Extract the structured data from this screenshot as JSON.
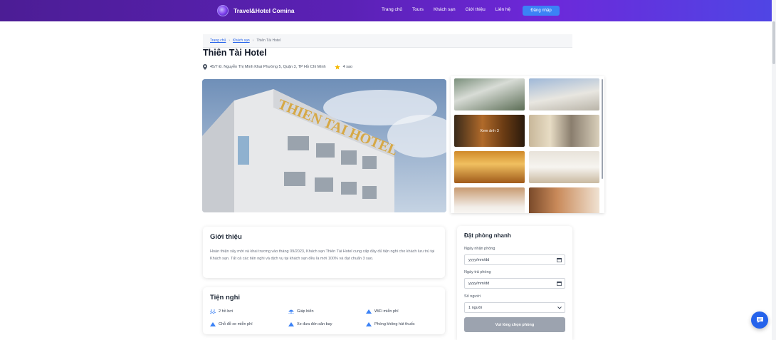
{
  "header": {
    "brand": "Travel&Hotel Comina",
    "nav": [
      "Trang chủ",
      "Tours",
      "Khách sạn",
      "Giới thiệu",
      "Liên hệ"
    ],
    "login_label": "Đăng nhập"
  },
  "breadcrumb": {
    "home": "Trang chủ",
    "hotels": "Khách sạn",
    "current": "Thiên Tài Hotel"
  },
  "hotel": {
    "name": "Thiên Tài Hotel",
    "address": "45/7 Đ. Nguyễn Thị Minh Khai Phường 5, Quận 3, TP Hồ Chí Minh",
    "stars": "4 sao"
  },
  "gallery": {
    "more_label": "Xem ảnh 3"
  },
  "intro": {
    "title": "Giới thiệu",
    "text": "Hoàn thiện xây mới và khai trương vào tháng 09/2023, Khách sạn Thiên Tài Hotel cung cấp đầy đủ tiện nghi cho khách lưu trú tại Khách sạn. Tất cả các tiện nghi và dịch vụ tại khách sạn đều là mới 100% và đạt chuẩn 3 sao."
  },
  "amenities": {
    "title": "Tiện nghi",
    "items": [
      "2 hồ bơi",
      "Giáp biển",
      "WiFi miễn phí",
      "Chỗ đỗ xe miễn phí",
      "Xe đưa đón sân bay",
      "Phòng không hút thuốc"
    ]
  },
  "booking": {
    "title": "Đặt phòng nhanh",
    "checkin_label": "Ngày nhận phòng",
    "checkin_value": "yyyy/mm/dd",
    "checkout_label": "Ngày trả phòng",
    "checkout_value": "yyyy/mm/dd",
    "guests_label": "Số người",
    "guests_value": "1 người",
    "submit_label": "Vui lòng chọn phòng"
  },
  "colors": {
    "header_start": "#4c1d95",
    "header_end": "#4f46e5",
    "accent": "#3b82f6",
    "star": "#f5b800"
  }
}
